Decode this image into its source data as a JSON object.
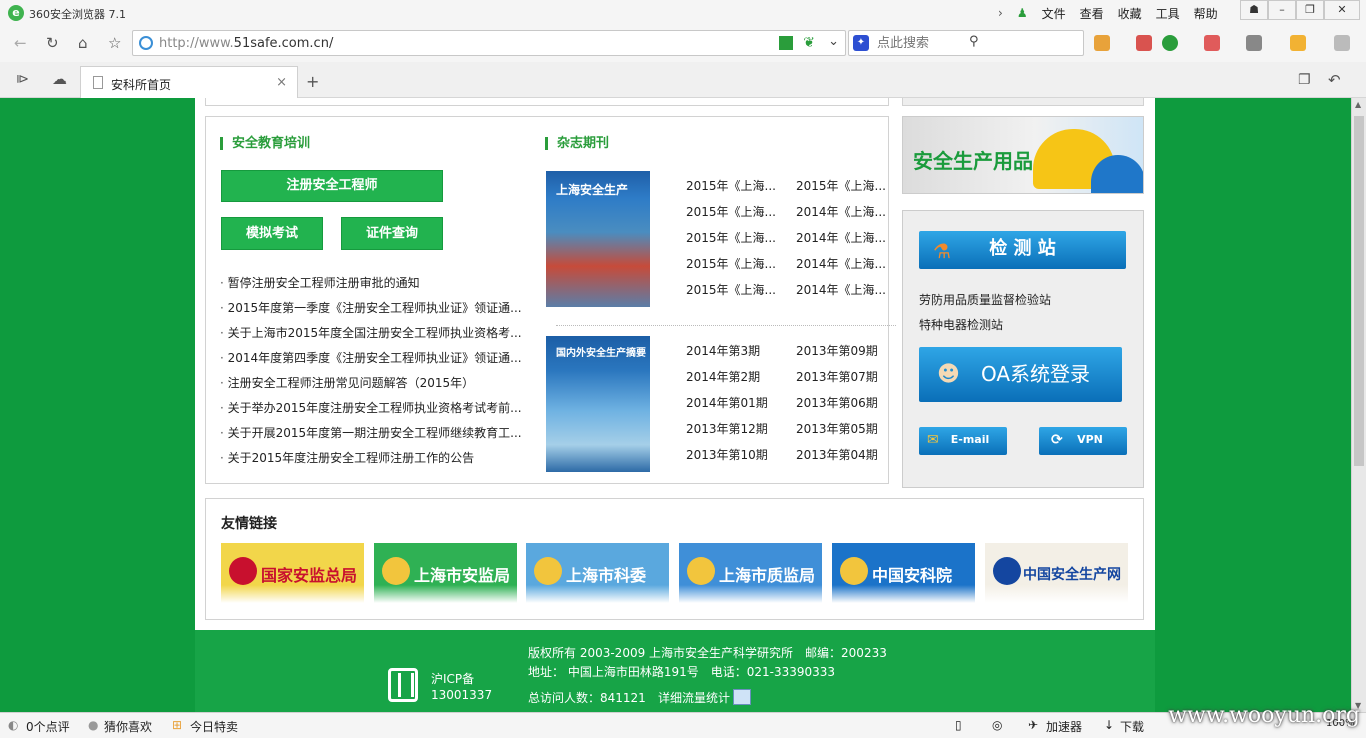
{
  "browser": {
    "title": "360安全浏览器 7.1",
    "menus": [
      "文件",
      "查看",
      "收藏",
      "工具",
      "帮助"
    ],
    "address_prefix": "http://www.",
    "address_domain": "51safe.com.cn/",
    "search_placeholder": "点此搜索",
    "tab_title": "安科所首页",
    "new_tab": "+"
  },
  "edu": {
    "title": "安全教育培训",
    "main_button": "注册安全工程师",
    "btn_mock": "模拟考试",
    "btn_cert": "证件查询",
    "news": [
      "暂停注册安全工程师注册审批的通知",
      "2015年度第一季度《注册安全工程师执业证》领证通...",
      "关于上海市2015年度全国注册安全工程师执业资格考...",
      "2014年度第四季度《注册安全工程师执业证》领证通...",
      "注册安全工程师注册常见问题解答（2015年）",
      "关于举办2015年度注册安全工程师执业资格考试考前...",
      "关于开展2015年度第一期注册安全工程师继续教育工...",
      "关于2015年度注册安全工程师注册工作的公告"
    ]
  },
  "journal": {
    "title": "杂志期刊",
    "cover1_title": "上海安全生产",
    "cover2_title": "国内外安全生产摘要",
    "issues1": [
      [
        "2015年《上海...",
        "2015年《上海..."
      ],
      [
        "2015年《上海...",
        "2014年《上海..."
      ],
      [
        "2015年《上海...",
        "2014年《上海..."
      ],
      [
        "2015年《上海...",
        "2014年《上海..."
      ],
      [
        "2015年《上海...",
        "2014年《上海..."
      ]
    ],
    "issues2": [
      [
        "2014年第3期",
        "2013年第09期"
      ],
      [
        "2014年第2期",
        "2013年第07期"
      ],
      [
        "2014年第01期",
        "2013年第06期"
      ],
      [
        "2013年第12期",
        "2013年第05期"
      ],
      [
        "2013年第10期",
        "2013年第04期"
      ]
    ]
  },
  "sidebar": {
    "banner_title": "安全生产用品",
    "station_button": "检 测 站",
    "link1": "劳防用品质量监督检验站",
    "link2": "特种电器检测站",
    "oa_button": "OA系统登录",
    "email_button": "E-mail",
    "vpn_button": "VPN"
  },
  "links": {
    "title": "友情链接",
    "items": [
      {
        "name": "国家安监总局",
        "bg": "#f2d64a",
        "fg": "#c8102e"
      },
      {
        "name": "上海市安监局",
        "bg": "#2fb154",
        "fg": "#ffffff"
      },
      {
        "name": "上海市科委",
        "bg": "#5aa8de",
        "fg": "#ffffff"
      },
      {
        "name": "上海市质监局",
        "bg": "#3f8fd8",
        "fg": "#ffffff"
      },
      {
        "name": "中国安科院",
        "bg": "#1b73c9",
        "fg": "#ffffff"
      },
      {
        "name": "中国安全生产网",
        "bg": "#f3efe6",
        "fg": "#1446a0"
      }
    ]
  },
  "footer": {
    "icp_label": "沪ICP备",
    "icp_number": "13001337",
    "line1": "版权所有 2003-2009 上海市安全生产科学研究所　邮编：200233",
    "line2": "地址： 中国上海市田林路191号　电话：021-33390333",
    "visits": "总访问人数：841121",
    "stats_link": "详细流量统计"
  },
  "status": {
    "comments": "0个点评",
    "guess": "猜你喜欢",
    "deals": "今日特卖",
    "accel": "加速器",
    "download": "下载",
    "zoom": "100%",
    "watermark": "www.wooyun.org"
  }
}
